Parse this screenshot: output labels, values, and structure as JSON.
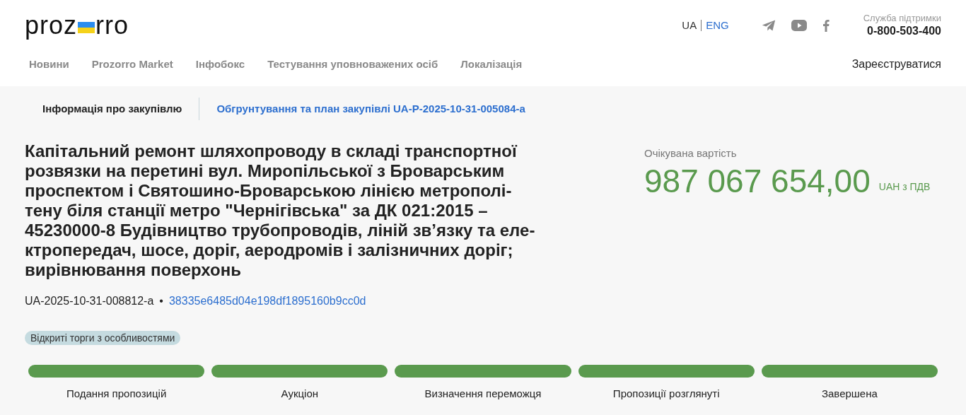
{
  "header": {
    "logo": {
      "left": "proz",
      "right": "rro"
    },
    "languages": [
      {
        "label": "UA",
        "selected": true
      },
      {
        "label": "ENG",
        "selected": false
      }
    ],
    "social": [
      {
        "kind": "telegram"
      },
      {
        "kind": "youtube"
      },
      {
        "kind": "facebook"
      }
    ],
    "support": {
      "label": "Служба підтримки",
      "phone": "0-800-503-400"
    },
    "nav": [
      "Новини",
      "Prozorro Market",
      "Інфобокс",
      "Тестування уповноважених осіб",
      "Локалізація"
    ],
    "register": "Зареєструватися"
  },
  "tabs": [
    {
      "label": "Інформація про закупівлю",
      "selected": true
    },
    {
      "label": "Обгрунтування та план закупівлі UA-P-2025-10-31-005084-a",
      "selected": false
    }
  ],
  "tender": {
    "title_lines": [
      "Капітальний ремонт шляхопроводу в складі транспортної",
      "розвязки на перетині вул. Миропільської з Броварським",
      "проспектом і Святошино-Броварською лінією метрополі-",
      "тену біля станції метро \"Чернігівська\" за ДК 021:2015 –",
      "45230000-8 Будівництво трубопроводів, ліній зв’язку та еле-",
      "ктропередач, шосе, доріг, аеродромів і залізничних доріг;",
      "вирівнювання поверхонь"
    ],
    "id": "UA-2025-10-31-008812-a",
    "separator": "•",
    "hash": "38335e6485d04e198df1895160b9cc0d",
    "procedure": "Відкриті торги з особливостями"
  },
  "value": {
    "label": "Очікувана вартість",
    "amount": "987 067 654,00",
    "currency": "UAH з ПДВ"
  },
  "stages": [
    {
      "label": "Подання пропозицій",
      "completed": true
    },
    {
      "label": "Аукціон",
      "completed": true
    },
    {
      "label": "Визначення переможця",
      "completed": true
    },
    {
      "label": "Пропозиції розглянуті",
      "completed": true
    },
    {
      "label": "Завершена",
      "completed": true
    }
  ]
}
